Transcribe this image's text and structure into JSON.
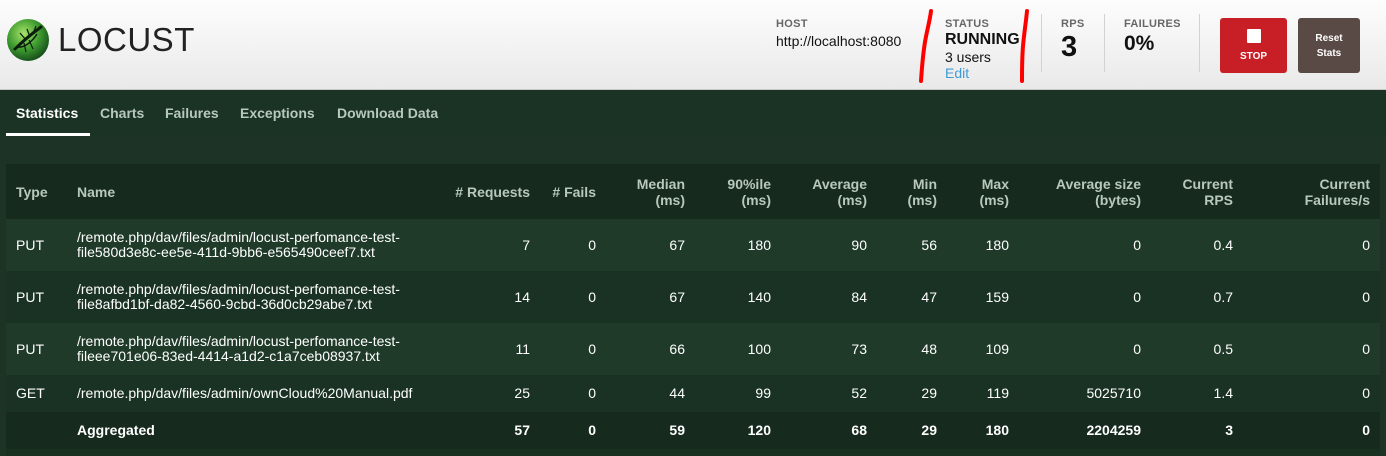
{
  "brand": {
    "name": "LOCUST"
  },
  "header": {
    "host": {
      "label": "HOST",
      "value": "http://localhost:8080"
    },
    "status": {
      "label": "STATUS",
      "value": "RUNNING",
      "users": "3 users",
      "edit": "Edit"
    },
    "rps": {
      "label": "RPS",
      "value": "3"
    },
    "failures": {
      "label": "FAILURES",
      "value": "0%"
    },
    "stop_label": "STOP",
    "reset_label": "Reset Stats"
  },
  "tabs": [
    {
      "label": "Statistics",
      "active": true
    },
    {
      "label": "Charts",
      "active": false
    },
    {
      "label": "Failures",
      "active": false
    },
    {
      "label": "Exceptions",
      "active": false
    },
    {
      "label": "Download Data",
      "active": false
    }
  ],
  "stats_table": {
    "columns": [
      "Type",
      "Name",
      "# Requests",
      "# Fails",
      "Median (ms)",
      "90%ile (ms)",
      "Average (ms)",
      "Min (ms)",
      "Max (ms)",
      "Average size (bytes)",
      "Current RPS",
      "Current Failures/s"
    ],
    "rows": [
      {
        "type": "PUT",
        "name_line1": "/remote.php/dav/files/admin/locust-perfomance-test-",
        "name_line2": "file580d3e8c-ee5e-411d-9bb6-e565490ceef7.txt",
        "requests": "7",
        "fails": "0",
        "median": "67",
        "p90": "180",
        "avg": "90",
        "min": "56",
        "max": "180",
        "avg_size": "0",
        "rps": "0.4",
        "fails_s": "0"
      },
      {
        "type": "PUT",
        "name_line1": "/remote.php/dav/files/admin/locust-perfomance-test-",
        "name_line2": "file8afbd1bf-da82-4560-9cbd-36d0cb29abe7.txt",
        "requests": "14",
        "fails": "0",
        "median": "67",
        "p90": "140",
        "avg": "84",
        "min": "47",
        "max": "159",
        "avg_size": "0",
        "rps": "0.7",
        "fails_s": "0"
      },
      {
        "type": "PUT",
        "name_line1": "/remote.php/dav/files/admin/locust-perfomance-test-",
        "name_line2": "fileee701e06-83ed-4414-a1d2-c1a7ceb08937.txt",
        "requests": "11",
        "fails": "0",
        "median": "66",
        "p90": "100",
        "avg": "73",
        "min": "48",
        "max": "109",
        "avg_size": "0",
        "rps": "0.5",
        "fails_s": "0"
      },
      {
        "type": "GET",
        "name_line1": "/remote.php/dav/files/admin/ownCloud%20Manual.pdf",
        "name_line2": "",
        "requests": "25",
        "fails": "0",
        "median": "44",
        "p90": "99",
        "avg": "52",
        "min": "29",
        "max": "119",
        "avg_size": "5025710",
        "rps": "1.4",
        "fails_s": "0"
      }
    ],
    "total": {
      "type": "",
      "name": "Aggregated",
      "requests": "57",
      "fails": "0",
      "median": "59",
      "p90": "120",
      "avg": "68",
      "min": "29",
      "max": "180",
      "avg_size": "2204259",
      "rps": "3",
      "fails_s": "0"
    }
  },
  "colors": {
    "stop": "#c81f26",
    "reset": "#5a4a45",
    "edit_link": "#3f9bd6",
    "annotation": "#ff0000"
  }
}
